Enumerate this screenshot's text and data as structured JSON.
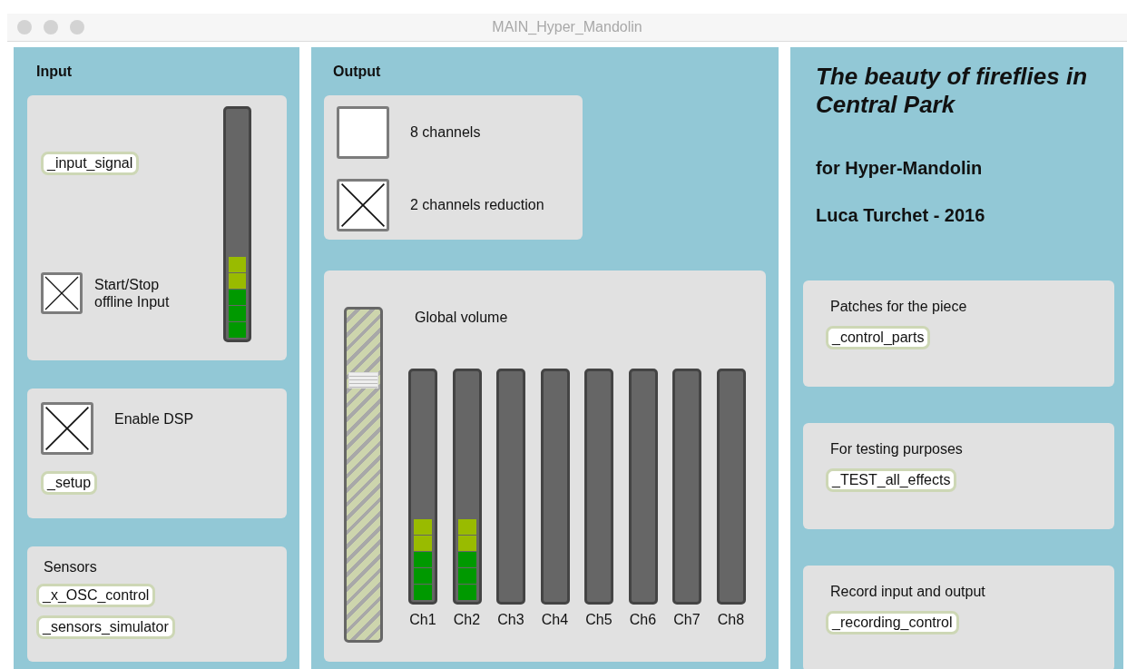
{
  "window": {
    "title": "MAIN_Hyper_Mandolin"
  },
  "input": {
    "heading": "Input",
    "signal_button": "_input_signal",
    "offline_toggle": {
      "label": "Start/Stop offline Input",
      "checked": true
    },
    "meter": {
      "level": 0.36
    },
    "dsp_toggle": {
      "label": "Enable DSP",
      "checked": true
    },
    "setup_button": "_setup",
    "sensors": {
      "heading": "Sensors",
      "buttons": [
        "_x_OSC_control",
        "_sensors_simulator"
      ]
    }
  },
  "output": {
    "heading": "Output",
    "modes": [
      {
        "label": "8 channels",
        "checked": false
      },
      {
        "label": "2 channels reduction",
        "checked": true
      }
    ],
    "global_volume": {
      "label": "Global volume",
      "level": 0.8
    },
    "channels": [
      {
        "name": "Ch1",
        "level": 0.36
      },
      {
        "name": "Ch2",
        "level": 0.36
      },
      {
        "name": "Ch3"
      },
      {
        "name": "Ch4"
      },
      {
        "name": "Ch5"
      },
      {
        "name": "Ch6"
      },
      {
        "name": "Ch7"
      },
      {
        "name": "Ch8"
      }
    ]
  },
  "piece": {
    "title": "The beauty of fireflies in Central Park",
    "subtitle": "for Hyper-Mandolin",
    "author": "Luca Turchet - 2016",
    "sections": [
      {
        "label": "Patches for the piece",
        "button": "_control_parts"
      },
      {
        "label": "For testing purposes",
        "button": "_TEST_all_effects"
      },
      {
        "label": "Record input and output",
        "button": "_recording_control"
      }
    ]
  }
}
